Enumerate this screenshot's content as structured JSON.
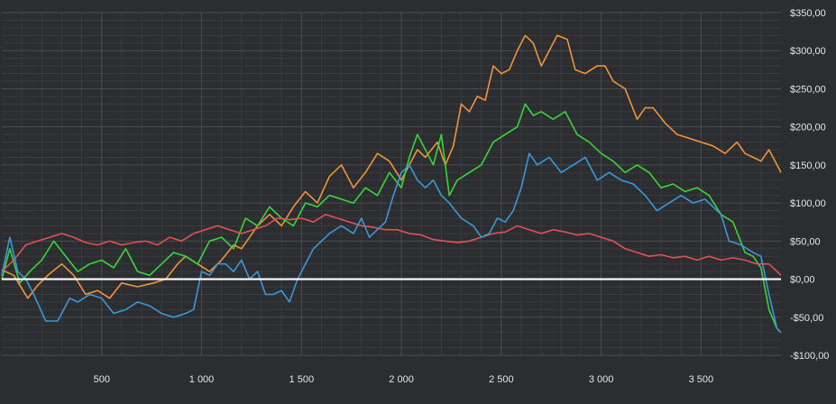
{
  "chart_data": {
    "type": "line",
    "title": "",
    "xlabel": "",
    "ylabel": "",
    "xlim": [
      0,
      3900
    ],
    "ylim": [
      -100,
      350
    ],
    "x_ticks": [
      500,
      1000,
      1500,
      2000,
      2500,
      3000,
      3500
    ],
    "x_tick_labels": [
      "500",
      "1 000",
      "1 500",
      "2 000",
      "2 500",
      "3 000",
      "3 500"
    ],
    "y_ticks": [
      -100,
      -50,
      0,
      50,
      100,
      150,
      200,
      250,
      300,
      350
    ],
    "y_tick_labels": [
      "-$100,00",
      "-$50,00",
      "$0,00",
      "$50,00",
      "$100,00",
      "$150,00",
      "$200,00",
      "$250,00",
      "$300,00",
      "$350,00"
    ],
    "grid": true,
    "legend": "none",
    "baseline": 0,
    "colors": {
      "background": "#2b2d30",
      "grid_major": "#4a4d52",
      "grid_minor": "#393b3f",
      "tick_text": "#e6e6e6",
      "baseline": "#ffffff"
    },
    "series": [
      {
        "color": "#f0933a",
        "x": [
          0,
          60,
          130,
          180,
          230,
          300,
          360,
          420,
          480,
          540,
          600,
          680,
          760,
          820,
          880,
          920,
          980,
          1040,
          1100,
          1160,
          1200,
          1280,
          1340,
          1400,
          1460,
          1520,
          1580,
          1640,
          1700,
          1760,
          1820,
          1880,
          1940,
          2000,
          2040,
          2080,
          2120,
          2180,
          2220,
          2260,
          2300,
          2340,
          2380,
          2420,
          2460,
          2500,
          2540,
          2580,
          2620,
          2660,
          2700,
          2740,
          2780,
          2830,
          2870,
          2920,
          2980,
          3020,
          3060,
          3120,
          3180,
          3220,
          3260,
          3320,
          3380,
          3440,
          3500,
          3560,
          3620,
          3680,
          3720,
          3760,
          3800,
          3840,
          3880,
          3900
        ],
        "y": [
          12,
          5,
          -25,
          -8,
          5,
          20,
          5,
          -20,
          -15,
          -25,
          -5,
          -10,
          -5,
          0,
          20,
          30,
          20,
          10,
          25,
          45,
          40,
          70,
          85,
          70,
          95,
          115,
          100,
          135,
          150,
          120,
          140,
          165,
          155,
          130,
          150,
          170,
          160,
          180,
          150,
          175,
          230,
          220,
          240,
          235,
          280,
          270,
          275,
          300,
          320,
          310,
          280,
          300,
          320,
          315,
          275,
          270,
          280,
          280,
          260,
          250,
          210,
          225,
          225,
          205,
          190,
          185,
          180,
          175,
          165,
          180,
          165,
          160,
          155,
          170,
          150,
          140
        ]
      },
      {
        "color": "#3ad43a",
        "x": [
          0,
          40,
          90,
          140,
          200,
          260,
          320,
          380,
          440,
          500,
          560,
          620,
          680,
          740,
          800,
          860,
          920,
          980,
          1040,
          1100,
          1160,
          1220,
          1280,
          1340,
          1400,
          1460,
          1520,
          1580,
          1640,
          1700,
          1760,
          1820,
          1880,
          1940,
          2000,
          2040,
          2080,
          2120,
          2160,
          2200,
          2240,
          2280,
          2340,
          2400,
          2460,
          2520,
          2580,
          2620,
          2660,
          2700,
          2760,
          2820,
          2880,
          2940,
          3000,
          3060,
          3120,
          3180,
          3240,
          3300,
          3360,
          3420,
          3480,
          3540,
          3600,
          3660,
          3720,
          3760,
          3800,
          3840,
          3880,
          3900
        ],
        "y": [
          0,
          40,
          -5,
          10,
          25,
          50,
          30,
          10,
          20,
          25,
          15,
          40,
          10,
          5,
          20,
          35,
          30,
          20,
          50,
          55,
          40,
          80,
          70,
          95,
          80,
          70,
          100,
          95,
          110,
          105,
          100,
          120,
          110,
          140,
          120,
          160,
          190,
          170,
          150,
          190,
          110,
          130,
          140,
          150,
          180,
          190,
          200,
          230,
          215,
          220,
          210,
          220,
          190,
          180,
          165,
          155,
          140,
          150,
          140,
          120,
          125,
          115,
          120,
          110,
          85,
          75,
          35,
          30,
          15,
          -40,
          -65,
          -70
        ]
      },
      {
        "color": "#e05252",
        "x": [
          0,
          60,
          120,
          180,
          240,
          300,
          360,
          420,
          480,
          540,
          600,
          660,
          720,
          780,
          840,
          900,
          960,
          1020,
          1080,
          1140,
          1200,
          1260,
          1320,
          1380,
          1440,
          1500,
          1560,
          1620,
          1680,
          1740,
          1800,
          1860,
          1920,
          1980,
          2040,
          2100,
          2160,
          2220,
          2280,
          2340,
          2400,
          2460,
          2520,
          2580,
          2640,
          2700,
          2760,
          2820,
          2880,
          2940,
          3000,
          3060,
          3120,
          3180,
          3240,
          3300,
          3360,
          3420,
          3480,
          3540,
          3600,
          3660,
          3720,
          3780,
          3840,
          3880,
          3900
        ],
        "y": [
          10,
          25,
          45,
          50,
          55,
          60,
          55,
          48,
          45,
          50,
          45,
          48,
          50,
          45,
          55,
          50,
          60,
          65,
          70,
          65,
          60,
          65,
          70,
          80,
          78,
          80,
          75,
          85,
          80,
          75,
          70,
          68,
          65,
          65,
          60,
          58,
          52,
          50,
          48,
          50,
          55,
          60,
          62,
          70,
          65,
          60,
          65,
          62,
          58,
          60,
          55,
          50,
          40,
          35,
          30,
          32,
          28,
          30,
          25,
          30,
          25,
          28,
          25,
          20,
          20,
          10,
          5
        ]
      },
      {
        "color": "#3a98d8",
        "x": [
          0,
          40,
          80,
          120,
          160,
          220,
          280,
          340,
          380,
          440,
          500,
          560,
          620,
          680,
          740,
          800,
          860,
          920,
          960,
          1000,
          1040,
          1080,
          1120,
          1160,
          1200,
          1240,
          1280,
          1320,
          1360,
          1400,
          1440,
          1480,
          1520,
          1560,
          1600,
          1640,
          1700,
          1760,
          1800,
          1840,
          1880,
          1920,
          1960,
          2000,
          2040,
          2080,
          2120,
          2160,
          2200,
          2240,
          2300,
          2360,
          2400,
          2440,
          2480,
          2520,
          2560,
          2600,
          2640,
          2680,
          2740,
          2800,
          2860,
          2920,
          2980,
          3040,
          3100,
          3160,
          3220,
          3280,
          3340,
          3400,
          3460,
          3520,
          3560,
          3600,
          3640,
          3700,
          3760,
          3800,
          3840,
          3880,
          3900
        ],
        "y": [
          5,
          55,
          10,
          0,
          -20,
          -55,
          -55,
          -25,
          -30,
          -20,
          -25,
          -45,
          -40,
          -30,
          -35,
          -45,
          -50,
          -45,
          -40,
          10,
          5,
          20,
          20,
          10,
          25,
          0,
          10,
          -20,
          -20,
          -15,
          -30,
          0,
          20,
          40,
          50,
          60,
          70,
          60,
          80,
          55,
          65,
          75,
          110,
          140,
          150,
          130,
          120,
          130,
          110,
          100,
          80,
          70,
          55,
          60,
          80,
          75,
          90,
          120,
          165,
          150,
          160,
          140,
          150,
          160,
          130,
          140,
          130,
          125,
          110,
          90,
          100,
          110,
          100,
          105,
          95,
          85,
          50,
          45,
          35,
          30,
          -20,
          -65,
          -70
        ]
      }
    ]
  }
}
